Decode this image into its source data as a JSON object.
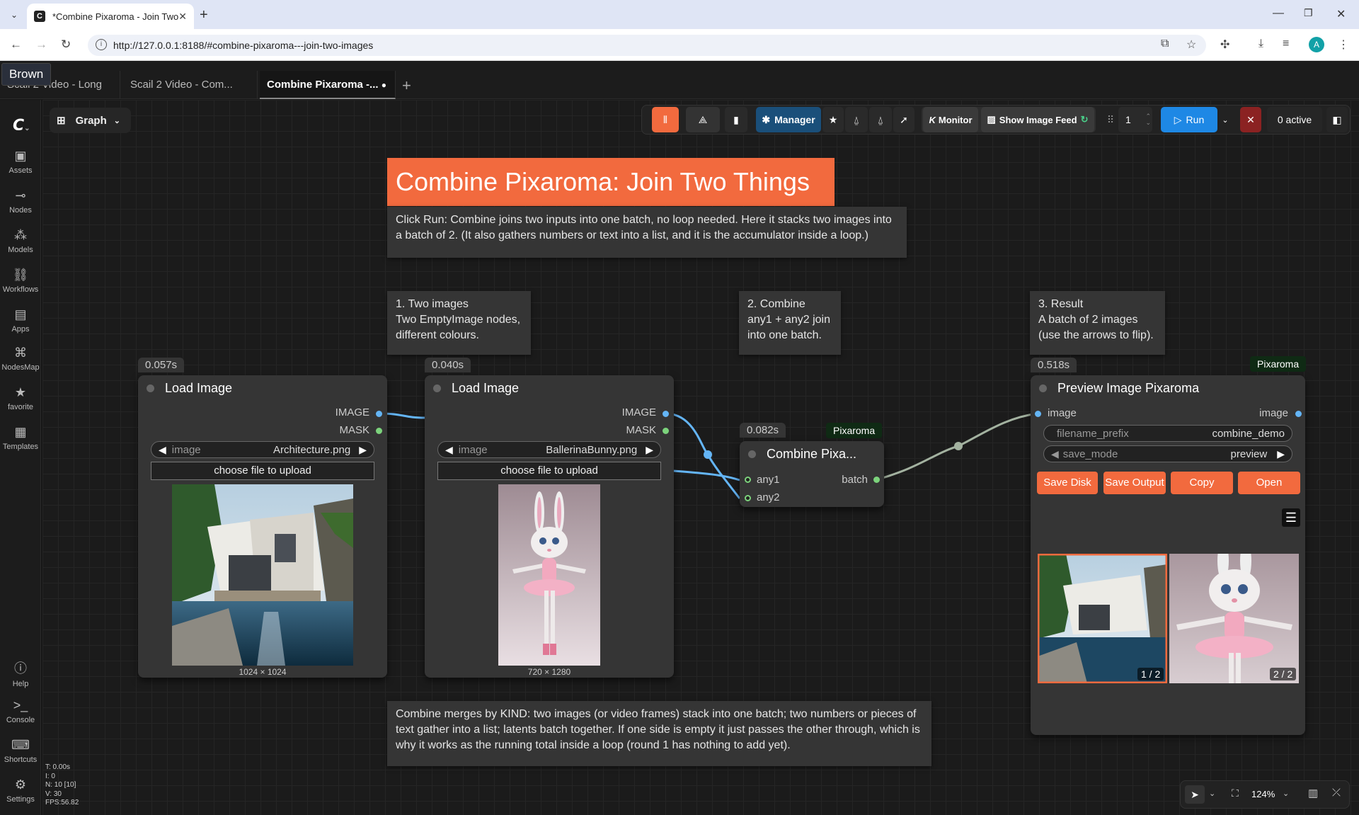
{
  "browser": {
    "tab_title": "*Combine Pixaroma - Join Two",
    "url": "http://127.0.0.1:8188/#combine-pixaroma---join-two-images",
    "profile_initial": "A"
  },
  "app_tabs": [
    {
      "label": "Scail 2 Video - Long"
    },
    {
      "label": "Scail 2 Video - Com..."
    },
    {
      "label": "Combine Pixaroma -..."
    }
  ],
  "tooltip": "Brown",
  "sidebar": {
    "items": [
      {
        "label": "Assets"
      },
      {
        "label": "Nodes"
      },
      {
        "label": "Models"
      },
      {
        "label": "Workflows"
      },
      {
        "label": "Apps"
      },
      {
        "label": "NodesMap"
      },
      {
        "label": "favorite"
      },
      {
        "label": "Templates"
      }
    ],
    "bottom": [
      {
        "label": "Help"
      },
      {
        "label": "Console"
      },
      {
        "label": "Shortcuts"
      },
      {
        "label": "Settings"
      }
    ]
  },
  "toolbar": {
    "graph_label": "Graph",
    "manager_label": "Manager",
    "monitor_label": "Monitor",
    "image_feed_label": "Show Image Feed",
    "batch_count": "1",
    "run_label": "Run",
    "active_label": "0 active"
  },
  "notes": {
    "title": "Combine Pixaroma: Join Two Things",
    "intro": "Click Run: Combine joins two inputs into one batch, no loop needed. Here it stacks two images into a batch of 2. (It also gathers numbers or text into a list, and it is the accumulator inside a loop.)",
    "step1": [
      "1. Two images",
      "Two EmptyImage nodes,",
      "different colours."
    ],
    "step2": [
      "2. Combine",
      "any1 + any2 join",
      "into one batch."
    ],
    "step3": [
      "3. Result",
      "A batch of 2 images",
      "(use the arrows to flip)."
    ],
    "bottom": "Combine merges by KIND: two images (or video frames) stack into one batch; two numbers or pieces of text gather into a list; latents batch together. If one side is empty it just passes the other through, which is why it works as the running total inside a loop (round 1 has nothing to add yet)."
  },
  "nodes": {
    "load1": {
      "time": "0.057s",
      "title": "Load Image",
      "out1": "IMAGE",
      "out2": "MASK",
      "widget_label": "image",
      "widget_value": "Architecture.png",
      "upload": "choose file to upload",
      "dims": "1024 × 1024"
    },
    "load2": {
      "time": "0.040s",
      "title": "Load Image",
      "out1": "IMAGE",
      "out2": "MASK",
      "widget_label": "image",
      "widget_value": "BallerinaBunny.png",
      "upload": "choose file to upload",
      "dims": "720 × 1280"
    },
    "combine": {
      "time": "0.082s",
      "tag": "Pixaroma",
      "title": "Combine Pixa...",
      "in1": "any1",
      "in2": "any2",
      "out": "batch"
    },
    "preview": {
      "time": "0.518s",
      "tag": "Pixaroma",
      "title": "Preview Image Pixaroma",
      "in": "image",
      "out": "image",
      "prefix_label": "filename_prefix",
      "prefix_value": "combine_demo",
      "mode_label": "save_mode",
      "mode_value": "preview",
      "buttons": [
        "Save Disk",
        "Save Output",
        "Copy",
        "Open"
      ],
      "counters": [
        "1 / 2",
        "2 / 2"
      ]
    }
  },
  "stats": [
    "T: 0.00s",
    "I: 0",
    "N: 10 [10]",
    "V: 30",
    "FPS:56.82"
  ],
  "zoom": "124%",
  "colors": {
    "accent": "#f26a3e",
    "run": "#1e88e5",
    "link_image": "#64b5f6",
    "link_any": "#a3b2a0",
    "dot_green": "#7cd37c"
  }
}
